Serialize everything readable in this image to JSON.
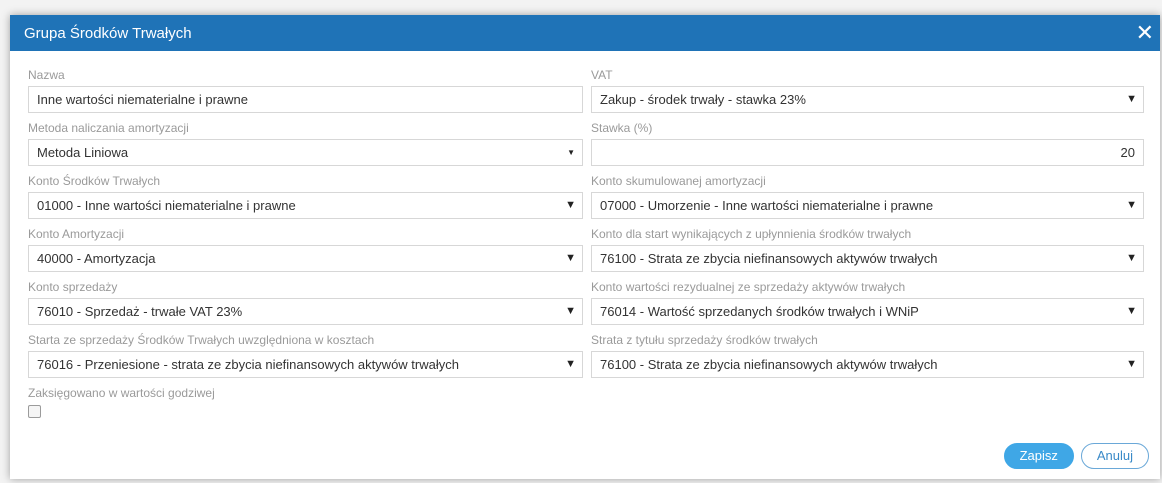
{
  "dialog": {
    "title": "Grupa Środków Trwałych"
  },
  "fields": {
    "nazwa": {
      "label": "Nazwa",
      "value": "Inne wartości niematerialne i prawne"
    },
    "vat": {
      "label": "VAT",
      "value": "Zakup - środek trwały - stawka 23%"
    },
    "metoda": {
      "label": "Metoda naliczania amortyzacji",
      "value": "Metoda Liniowa"
    },
    "stawka": {
      "label": "Stawka (%)",
      "value": "20"
    },
    "konto_st": {
      "label": "Konto Środków Trwałych",
      "value": "01000 - Inne wartości niematerialne i prawne"
    },
    "konto_skum": {
      "label": "Konto skumulowanej amortyzacji",
      "value": "07000 - Umorzenie - Inne wartości niematerialne i prawne"
    },
    "konto_amort": {
      "label": "Konto Amortyzacji",
      "value": "40000 - Amortyzacja"
    },
    "konto_start": {
      "label": "Konto dla start wynikających z upłynnienia środków trwałych",
      "value": "76100 - Strata ze zbycia niefinansowych aktywów trwałych"
    },
    "konto_sprz": {
      "label": "Konto sprzedaży",
      "value": "76010 - Sprzedaż - trwałe VAT 23%"
    },
    "konto_rezyd": {
      "label": "Konto wartości rezydualnej ze sprzedaży aktywów trwałych",
      "value": "76014 - Wartość sprzedanych środków trwałych i WNiP"
    },
    "strata_koszt": {
      "label": "Starta ze sprzedaży Środków Trwałych uwzględniona w kosztach",
      "value": "76016 - Przeniesione - strata ze zbycia niefinansowych aktywów trwałych"
    },
    "strata_tytul": {
      "label": "Strata z tytułu sprzedaży środków trwałych",
      "value": "76100 - Strata ze zbycia niefinansowych aktywów trwałych"
    },
    "zaksiegowano": {
      "label": "Zaksięgowano w wartości godziwej",
      "checked": false
    }
  },
  "buttons": {
    "save": "Zapisz",
    "cancel": "Anuluj"
  },
  "icons": {
    "close": "close-icon",
    "dropdown": "chevron-down-icon"
  },
  "colors": {
    "header": "#1f73b7",
    "primary_button": "#3fa7e6"
  }
}
